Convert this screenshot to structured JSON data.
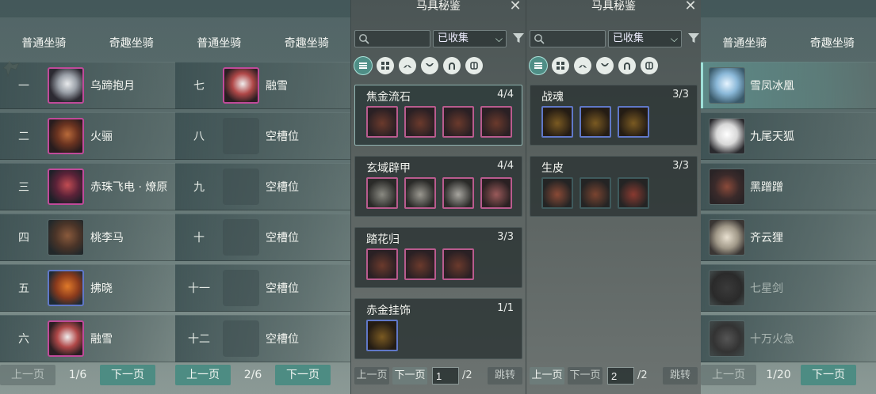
{
  "tabs": {
    "normal": "普通坐骑",
    "fun": "奇趣坐骑"
  },
  "panel1": {
    "rows": [
      {
        "num": "一",
        "name": "乌蹄抱月",
        "avatar_icon": "white-horse-icon"
      },
      {
        "num": "二",
        "name": "火骊",
        "avatar_icon": "brown-horse-icon"
      },
      {
        "num": "三",
        "name": "赤珠飞电 · 燎原",
        "avatar_icon": "red-horse-icon"
      },
      {
        "num": "四",
        "name": "桃李马",
        "avatar_icon": "horse-icon"
      },
      {
        "num": "五",
        "name": "拂晓",
        "avatar_icon": "flame-horse-icon"
      },
      {
        "num": "六",
        "name": "融雪",
        "avatar_icon": "white-horse-icon"
      }
    ],
    "prev": "上一页",
    "page": "1/6",
    "next": "下一页"
  },
  "panel2": {
    "rows": [
      {
        "num": "七",
        "name": "融雪",
        "avatar_icon": "white-horse-icon"
      },
      {
        "num": "八",
        "name": "空槽位",
        "avatar_icon": "empty-slot-icon"
      },
      {
        "num": "九",
        "name": "空槽位",
        "avatar_icon": "empty-slot-icon"
      },
      {
        "num": "十",
        "name": "空槽位",
        "avatar_icon": "empty-slot-icon"
      },
      {
        "num": "十一",
        "name": "空槽位",
        "avatar_icon": "empty-slot-icon"
      },
      {
        "num": "十二",
        "name": "空槽位",
        "avatar_icon": "empty-slot-icon"
      }
    ],
    "prev": "上一页",
    "page": "2/6",
    "next": "下一页"
  },
  "codex": {
    "title": "马具秘鉴",
    "filter_value": "已收集",
    "search_placeholder": "",
    "prev": "上一页",
    "next": "下一页",
    "total": "/2",
    "jump": "跳转"
  },
  "panel3": {
    "page_input": "1",
    "cards": [
      {
        "name": "焦金流石",
        "count": "4/4",
        "items": 4
      },
      {
        "name": "玄域辟甲",
        "count": "4/4",
        "items": 4
      },
      {
        "name": "踏花归",
        "count": "3/3",
        "items": 3
      },
      {
        "name": "赤金挂饰",
        "count": "1/1",
        "items": 1
      }
    ]
  },
  "panel4": {
    "page_input": "2",
    "cards": [
      {
        "name": "战魂",
        "count": "3/3",
        "items": 3
      },
      {
        "name": "生皮",
        "count": "3/3",
        "items": 3
      }
    ]
  },
  "panel5": {
    "rows": [
      {
        "name": "雪凤冰凰",
        "avatar_icon": "ice-phoenix-icon",
        "selected": true,
        "owned": true
      },
      {
        "name": "九尾天狐",
        "avatar_icon": "white-fox-icon",
        "owned": true
      },
      {
        "name": "黑蹭蹭",
        "avatar_icon": "black-pig-icon",
        "owned": true
      },
      {
        "name": "齐云狸",
        "avatar_icon": "cat-icon",
        "owned": true
      },
      {
        "name": "七星剑",
        "avatar_icon": "sword-icon",
        "owned": false
      },
      {
        "name": "十万火急",
        "avatar_icon": "fire-wheel-icon",
        "owned": false
      }
    ],
    "prev": "上一页",
    "page": "1/20",
    "next": "下一页"
  },
  "colors": {
    "accent": "#4d8c83",
    "rarity_purple": "#c04a9a",
    "rarity_blue": "#6078c8"
  }
}
